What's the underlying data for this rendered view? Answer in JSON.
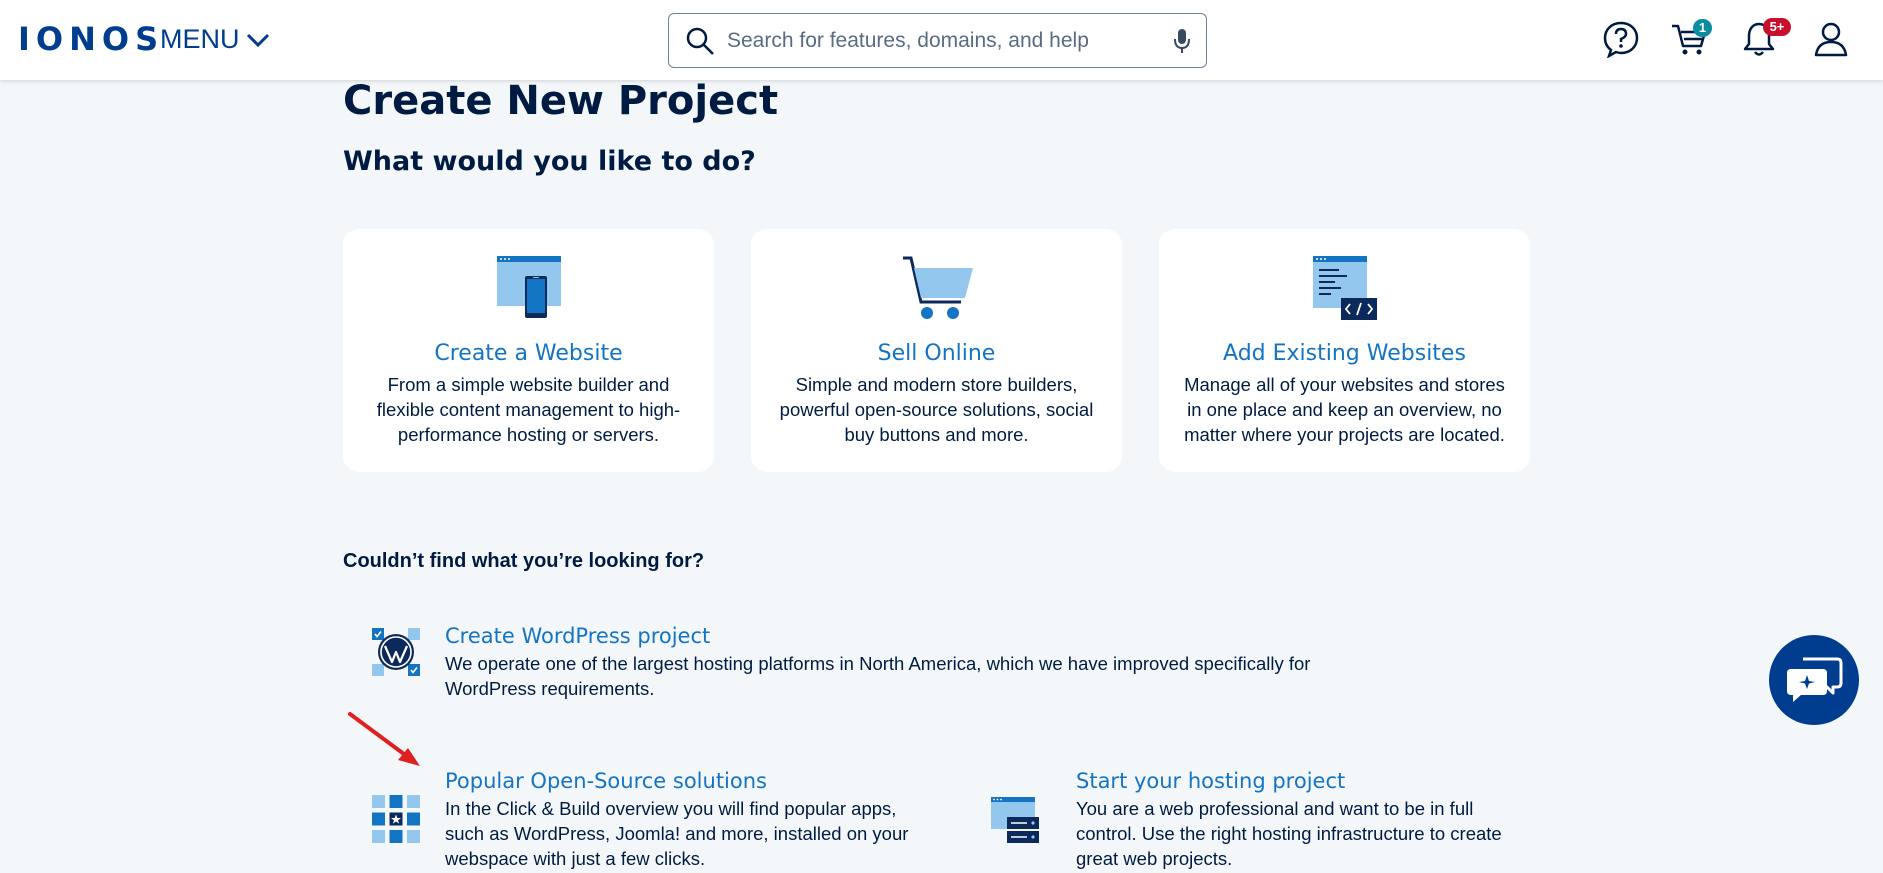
{
  "header": {
    "logo": "IONOS",
    "menu_label": "MENU",
    "search_placeholder": "Search for features, domains, and help",
    "cart_count": "1",
    "notifications_count": "5+"
  },
  "main": {
    "title": "Create New Project",
    "subtitle": "What would you like to do?",
    "cards": [
      {
        "title": "Create a Website",
        "desc": "From a simple website builder and flexible content management to high-performance hosting or servers."
      },
      {
        "title": "Sell Online",
        "desc": "Simple and modern store builders, powerful open-source solutions, social buy buttons and more."
      },
      {
        "title": "Add Existing Websites",
        "desc": "Manage all of your websites and stores in one place and keep an overview, no matter where your projects are located."
      }
    ],
    "looking_heading": "Couldn’t find what you’re looking for?",
    "options": [
      {
        "title": "Create WordPress project",
        "desc": "We operate one of the largest hosting platforms in North America, which we have improved specifically for WordPress requirements."
      },
      {
        "title": "Popular Open-Source solutions",
        "desc": "In the Click & Build overview you will find popular apps, such as WordPress, Joomla! and more, installed on your webspace with just a few clicks."
      },
      {
        "title": "Start your hosting project",
        "desc": "You are a web professional and want to be in full control. Use the right hosting infrastructure to create great web projects."
      }
    ]
  },
  "colors": {
    "brand": "#003d8f",
    "link": "#1474c4",
    "background": "#f4f7fa",
    "badge_cart": "#0b8ca0",
    "badge_notifications": "#c8102e",
    "annotation_arrow": "#e02020"
  },
  "icons": [
    "chevron-down-icon",
    "search-icon",
    "microphone-icon",
    "help-icon",
    "cart-icon",
    "bell-icon",
    "user-icon",
    "chat-icon"
  ]
}
